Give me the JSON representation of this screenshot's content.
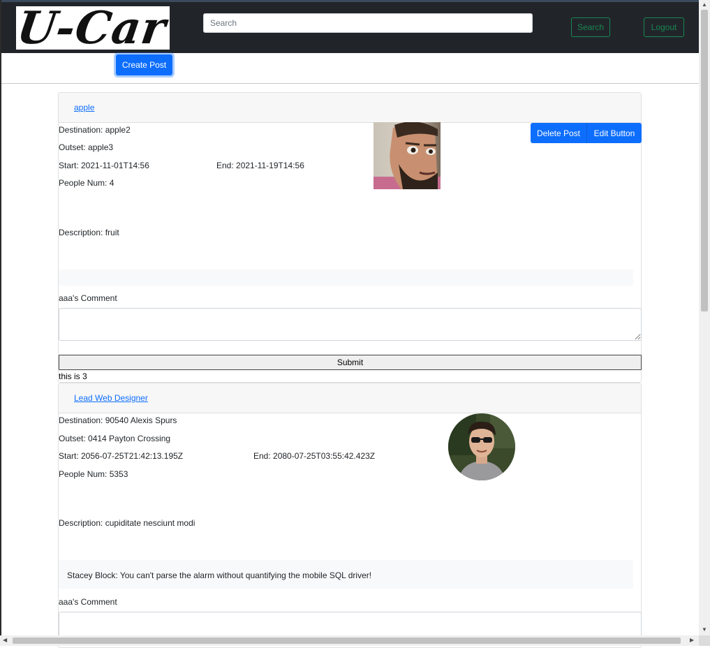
{
  "navbar": {
    "logo_text": "U-Car",
    "search_placeholder": "Search",
    "search_button": "Search",
    "logout_button": "Logout"
  },
  "create_post_label": "Create Post",
  "posts": [
    {
      "title": "apple",
      "destination": "Destination: apple2",
      "outset": "Outset: apple3",
      "start": "Start: 2021-11-01T14:56",
      "end": "End: 2021-11-19T14:56",
      "people": "People Num: 4",
      "description": "Description: fruit",
      "photo": "bearded-man-photo",
      "delete_label": "Delete Post",
      "edit_label": "Edit Button",
      "comment": "",
      "comment_label": "aaa's Comment",
      "submit_label": "Submit",
      "footer_text": "this is 3"
    },
    {
      "title": "Lead Web Designer",
      "destination": "Destination: 90540 Alexis Spurs",
      "outset": "Outset: 0414 Payton Crossing",
      "start": "Start: 2056-07-25T21:42:13.195Z",
      "end": "End: 2080-07-25T03:55:42.423Z",
      "people": "People Num: 5353",
      "description": "Description: cupiditate nesciunt modi",
      "photo": "man-with-sunglasses-avatar",
      "comment": "Stacey Block: You can't parse the alarm without quantifying the mobile SQL driver!",
      "comment_label": "aaa's Comment"
    }
  ],
  "colors": {
    "navbar_bg": "#212529",
    "primary": "#0d6efd",
    "success_outline": "#198754",
    "card_header_bg": "#f7f7f7"
  }
}
